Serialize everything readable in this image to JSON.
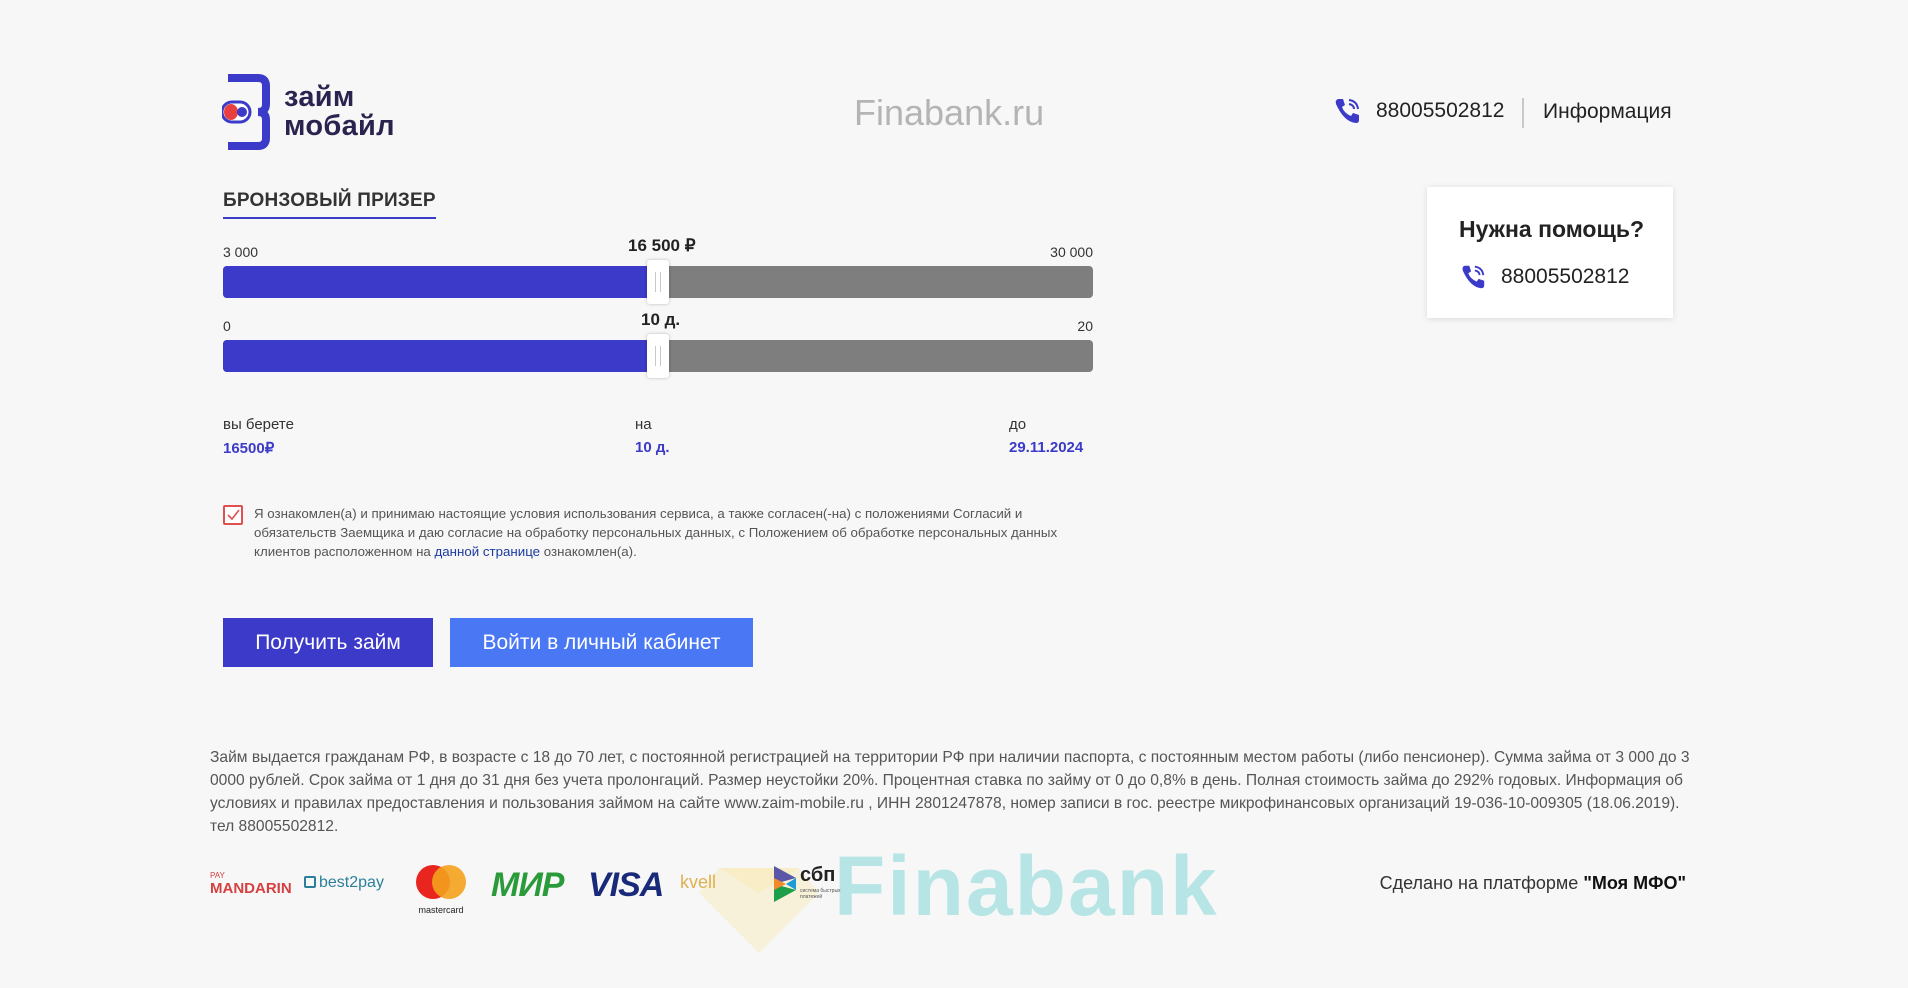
{
  "header": {
    "logo_text_line1": "займ",
    "logo_text_line2": "мобайл",
    "watermark": "Finabank.ru",
    "phone": "88005502812",
    "info_link": "Информация"
  },
  "loan_form": {
    "title": "БРОНЗОВЫЙ ПРИЗЕР",
    "amount_slider": {
      "min_label": "3 000",
      "max_label": "30 000",
      "value_label": "16 500 ₽",
      "min": 3000,
      "max": 30000,
      "value": 16500
    },
    "days_slider": {
      "min_label": "0",
      "max_label": "20",
      "value_label": "10 д.",
      "min": 0,
      "max": 20,
      "value": 10
    },
    "summary": {
      "take_label": "вы берете",
      "take_value": "16500₽",
      "term_label": "на",
      "term_value": "10 д.",
      "until_label": "до",
      "until_value": "29.11.2024"
    },
    "consent": {
      "checked": true,
      "text_before": "Я ознакомлен(а) и принимаю настоящие условия использования сервиса, а также согласен(-на) с положениями Согласий и обязательств Заемщика и даю согласие на обработку персональных данных, с Положением об обработке персональных данных клиентов расположенном на ",
      "link_text": "данной странице",
      "text_after": " ознакомлен(а)."
    },
    "primary_button": "Получить займ",
    "secondary_button": "Войти в личный кабинет"
  },
  "help_card": {
    "title": "Нужна помощь?",
    "phone": "88005502812"
  },
  "footer": {
    "disclaimer": "Займ выдается гражданам РФ, в возрасте с 18 до 70 лет, с постоянной регистрацией на территории РФ при наличии паспорта, с постоянным местом работы (либо пенсионер). Сумма займа от 3 000 до 3 0000 рублей. Срок займа от 1 дня до 31 дня без учета пролонгаций. Размер неустойки 20%. Процентная ставка по займу от 0 до 0,8% в день. Полная стоимость займа до 292% годовых. Информация об условиях и правилах предоставления и пользования займом на сайте www.zaim-mobile.ru , ИНН 2801247878, номер записи в гос. реестре микрофинансовых организаций 19-036-10-009305 (18.06.2019). тел 88005502812.",
    "payments": {
      "mandarin_top": "PAY",
      "mandarin": "MANDARIN",
      "best2pay": "best2pay",
      "mastercard": "mastercard",
      "mir": "МИР",
      "visa": "VISA",
      "kvell": "kvell",
      "sbp": "сбп",
      "sbp_sub": "система быстрых платежей"
    },
    "watermark": "Finabank",
    "platform_prefix": "Сделано на платформе ",
    "platform_name": "\"Моя МФО\""
  },
  "colors": {
    "accent": "#3c3ac8",
    "secondary_button": "#4a78f5",
    "track": "#7e7e7e",
    "background": "#f7f7f7",
    "checkbox_border": "#e05050"
  },
  "icons": [
    "phone-icon",
    "check-icon",
    "logo-icon"
  ]
}
